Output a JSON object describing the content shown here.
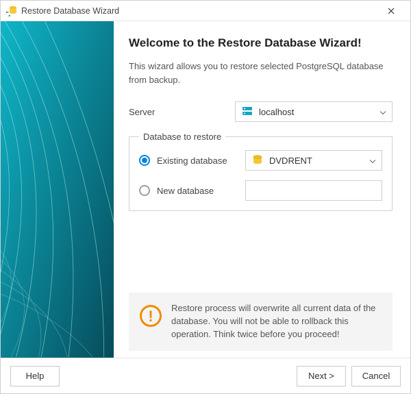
{
  "titlebar": {
    "title": "Restore Database Wizard"
  },
  "page": {
    "heading": "Welcome to the Restore Database Wizard!",
    "intro": "This wizard allows you to restore selected PostgreSQL database from backup.",
    "server_label": "Server",
    "server_value": "localhost",
    "group_legend": "Database to restore",
    "option_existing_label": "Existing database",
    "option_existing_value": "DVDRENT",
    "option_new_label": "New database",
    "option_new_value": "",
    "warning": "Restore process will overwrite all current data of the database. You will not be able to rollback this operation. Think twice before you proceed!"
  },
  "footer": {
    "help": "Help",
    "next": "Next >",
    "cancel": "Cancel"
  },
  "colors": {
    "accent": "#0a84d6",
    "warn": "#f08c00"
  }
}
